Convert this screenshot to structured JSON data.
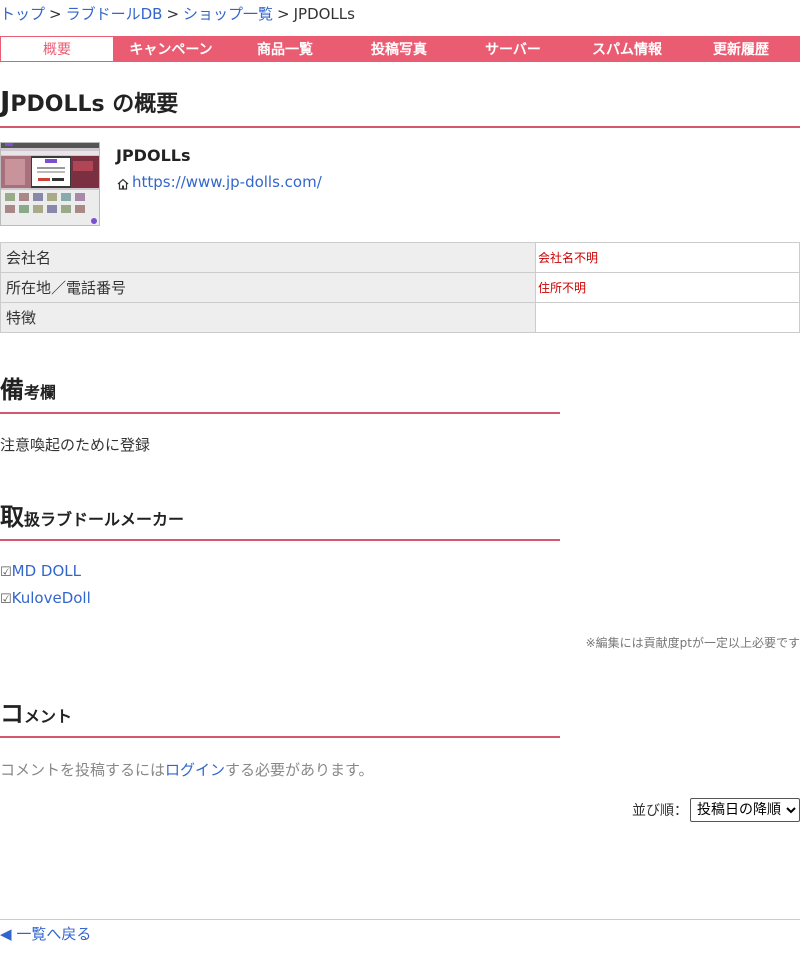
{
  "breadcrumb": {
    "items": [
      "トップ",
      "ラブドールDB",
      "ショップ一覧"
    ],
    "separator": ">",
    "current": "JPDOLLs"
  },
  "tabs": [
    "概要",
    "キャンペーン",
    "商品一覧",
    "投稿写真",
    "サーバー",
    "スパム情報",
    "更新履歴"
  ],
  "heading": {
    "first": "J",
    "rest": "PDOLLs の概要"
  },
  "shop": {
    "name": "JPDOLLs",
    "url": "https://www.jp-dolls.com/"
  },
  "info": [
    {
      "key": "会社名",
      "value": "会社名不明"
    },
    {
      "key": "所在地／電話番号",
      "value": "住所不明"
    },
    {
      "key": "特徴",
      "value": ""
    }
  ],
  "remarks": {
    "heading_big": "備",
    "heading_small": "考欄",
    "text": "注意喚起のために登録"
  },
  "makers": {
    "heading_big": "取",
    "heading_small": "扱ラブドールメーカー",
    "checkbox": "☑",
    "items": [
      "MD DOLL",
      "KuloveDoll"
    ]
  },
  "edit_note": "※編集には貢献度ptが一定以上必要です",
  "comments": {
    "heading_big": "コ",
    "heading_small": "メント",
    "text_before": "コメントを投稿するには",
    "login_link": "ログイン",
    "text_after": "する必要があります。"
  },
  "sort": {
    "label": "並び順：",
    "selected": "投稿日の降順"
  },
  "back": {
    "arrow": "◀",
    "label": "一覧へ戻る"
  },
  "colors": {
    "accent": "#ea5c72",
    "link": "#3366cc",
    "warning": "#cc0000"
  }
}
